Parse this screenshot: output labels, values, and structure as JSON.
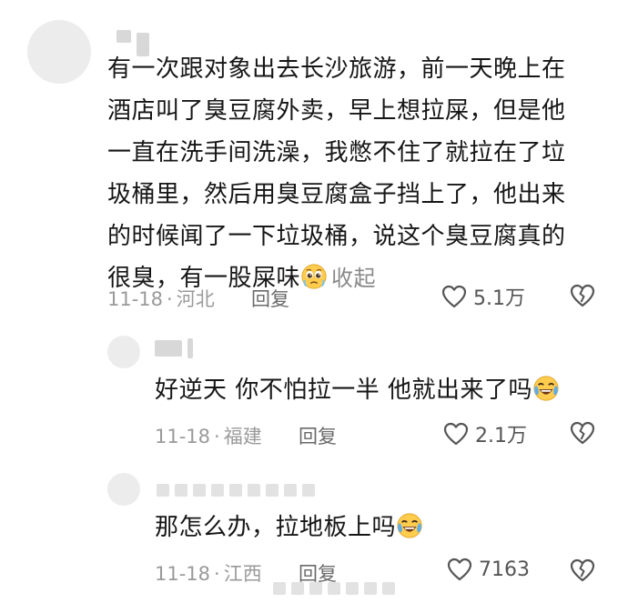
{
  "comments": [
    {
      "lines": [
        "有一次跟对象出去长沙旅游，前一天晚上在",
        "酒店叫了臭豆腐外卖，早上想拉屎，但是他",
        "一直在洗手间洗澡，我憋不住了就拉在了垃",
        "圾桶里，然后用臭豆腐盒子挡上了，他出来",
        "的时候闻了一下垃圾桶，说这个臭豆腐真的",
        "很臭，有一股屎味"
      ],
      "emoji": "pleading-face",
      "collapse_label": "收起",
      "date": "11-18",
      "separator": "·",
      "location": "河北",
      "reply_label": "回复",
      "likes": "5.1万"
    },
    {
      "text": "好逆天 你不怕拉一半 他就出来了吗",
      "emoji": "laughing-crying-face",
      "date": "11-18",
      "separator": "·",
      "location": "福建",
      "reply_label": "回复",
      "likes": "2.1万"
    },
    {
      "text": "那怎么办，拉地板上吗",
      "emoji": "laughing-crying-face",
      "date": "11-18",
      "separator": "·",
      "location": "江西",
      "reply_label": "回复",
      "likes": "7163"
    }
  ],
  "icons": {
    "like": "heart-outline-icon",
    "dislike": "broken-heart-icon"
  },
  "colors": {
    "text": "#161616",
    "meta": "#9a9a9a",
    "avatar": "#ececec"
  }
}
